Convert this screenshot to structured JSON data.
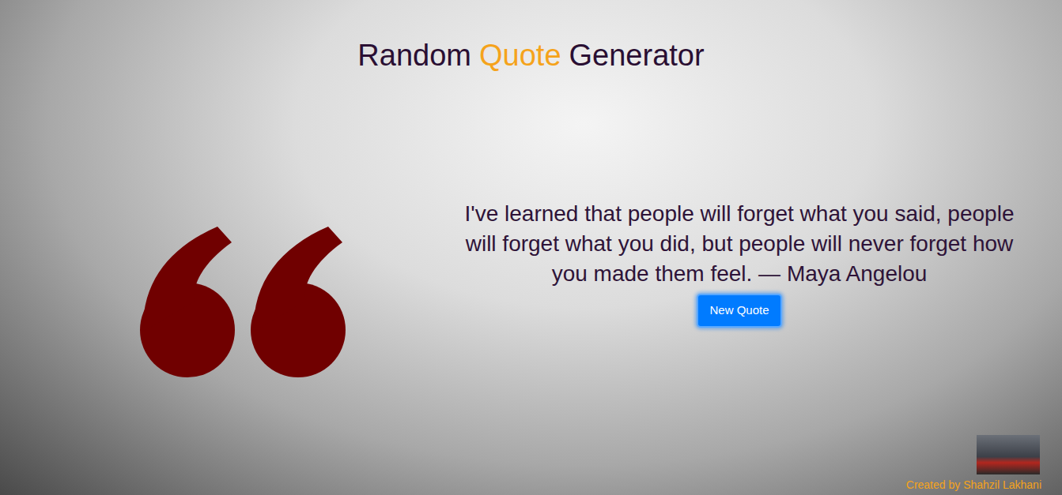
{
  "header": {
    "before": "Random",
    "highlight": "Quote",
    "after": "Generator"
  },
  "quote": {
    "text": "I've learned that people will forget what you said, people will forget what you did, but people will never forget how you made them feel. — Maya Angelou"
  },
  "button": {
    "label": "New Quote"
  },
  "footer": {
    "credit": "Created by Shahzil Lakhani"
  }
}
